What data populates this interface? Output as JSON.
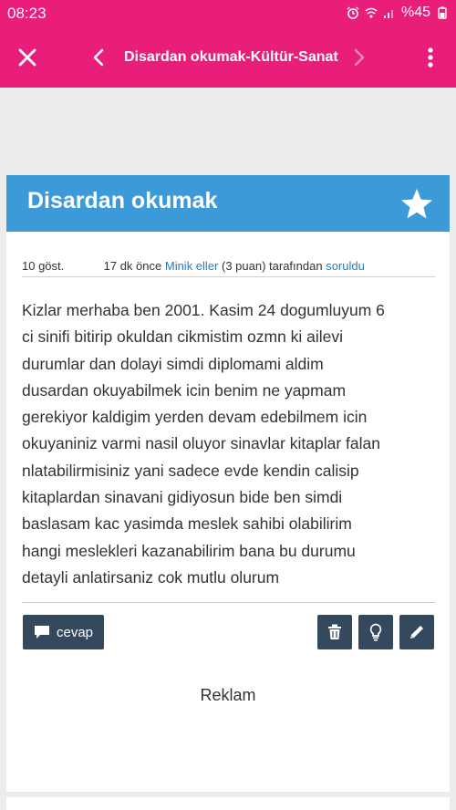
{
  "status_bar": {
    "time": "08:23",
    "battery": "%45",
    "icons": [
      "alarm-icon",
      "wifi-icon",
      "signal-icon",
      "battery-icon"
    ]
  },
  "app_bar": {
    "title": "Disardan okumak-Kültür-Sanat",
    "background": "#e91e7a",
    "icons": [
      "close-icon",
      "chevron-left-icon",
      "chevron-right-icon",
      "more-vertical-icon"
    ]
  },
  "question": {
    "header_color": "#3d9ad8",
    "title": "Disardan okumak",
    "star_icon": "star-icon",
    "meta": {
      "views": "10 göst.",
      "time": "17 dk önce",
      "user": "Minik eller",
      "points": "(3 puan) tarafından",
      "action": "soruldu"
    },
    "body_lines": [
      "Kizlar merhaba ben 2001. Kasim 24 dogumluyum 6",
      "ci sinifi bitirip okuldan cikmistim ozmn ki ailevi",
      "durumlar dan dolayi simdi diplomami aldim",
      "dusardan okuyabilmek icin benim ne yapmam",
      "gerekiyor kaldigim yerden devam edebilmem icin",
      "okuyaniniz varmi nasil oluyor sinavlar kitaplar falan",
      "nlatabilirmisiniz yani sadece evde kendin calisip",
      "kitaplardan sinavani gidiyosun bide ben simdi",
      "baslasam kac yasimda meslek sahibi olabilirim",
      "hangi meslekleri kazanabilirim bana bu durumu",
      "detayli anlatirsaniz cok mutlu olurum"
    ]
  },
  "actions": {
    "answer_label": "cevap",
    "answer_icon": "comment-icon",
    "delete_icon": "trash-icon",
    "hint_icon": "lightbulb-icon",
    "edit_icon": "pencil-icon",
    "button_color": "#34495e"
  },
  "ad": {
    "label": "Reklam"
  }
}
